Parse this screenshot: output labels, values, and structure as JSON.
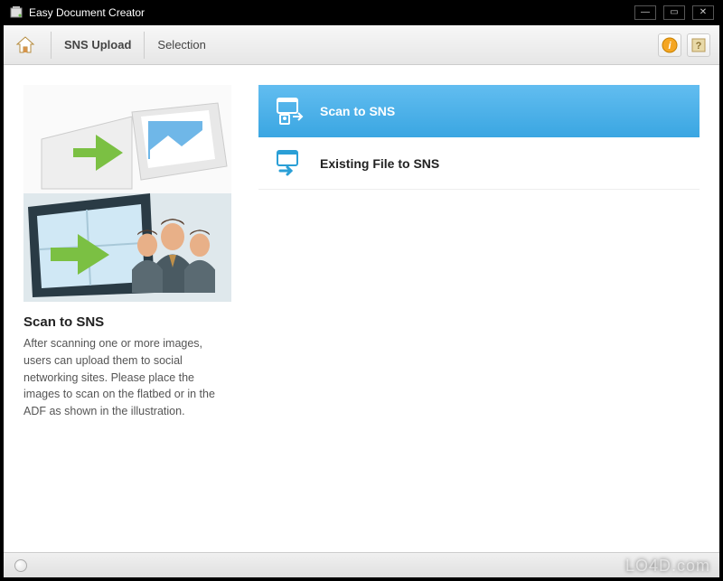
{
  "app": {
    "title": "Easy Document Creator"
  },
  "toolbar": {
    "breadcrumb_primary": "SNS Upload",
    "breadcrumb_secondary": "Selection"
  },
  "side": {
    "heading": "Scan to SNS",
    "description": "After scanning one or more images, users can upload them to social networking sites. Please place the images to scan on the flatbed or in the ADF as shown in the illustration."
  },
  "options": [
    {
      "label": "Scan to SNS",
      "selected": true
    },
    {
      "label": "Existing File to SNS",
      "selected": false
    }
  ],
  "watermark": "LO4D.com"
}
